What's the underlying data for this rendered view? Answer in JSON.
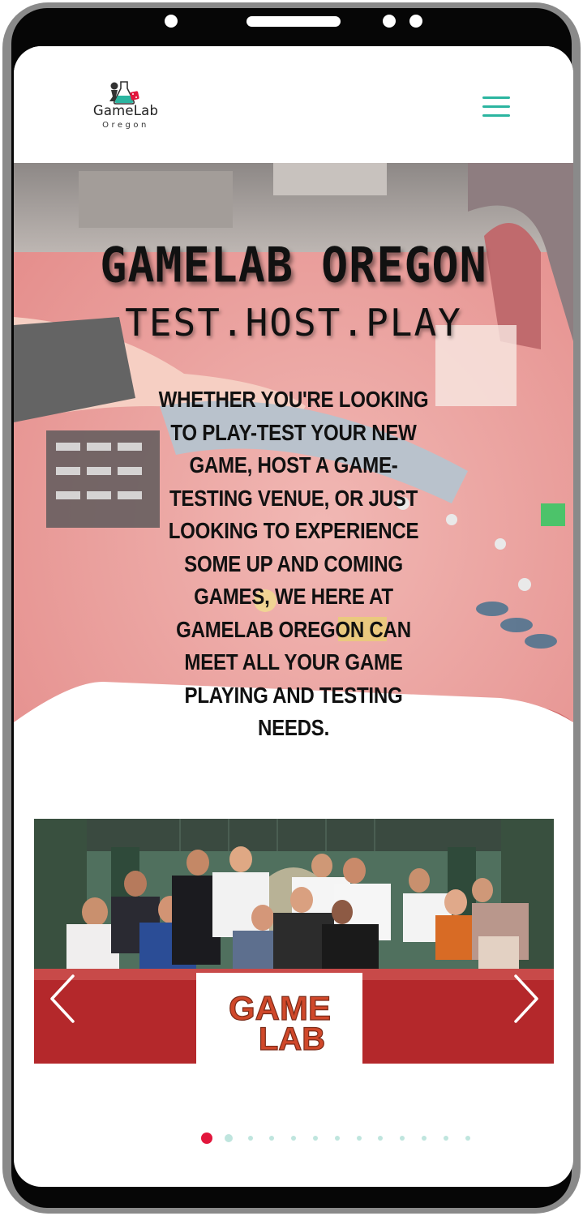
{
  "header": {
    "logo_text": "GameLab",
    "logo_subtext": "Oregon"
  },
  "hero": {
    "title": "GAMELAB OREGON",
    "tagline": "TEST.HOST.PLAY",
    "description": "Whether you're looking to play-test your new game, host a game-testing venue, or just looking to experience some up and coming games, we here at GameLab Oregon can meet all your game playing and testing needs."
  },
  "slider": {
    "banner_text_line1": "GAME",
    "banner_text_line2": "LAB",
    "slide_count": 13,
    "active_slide": 1
  },
  "colors": {
    "accent": "#2bb5a0",
    "active_dot": "#e2163c",
    "inactive_dot": "#bfe5de",
    "hero_overlay": "#e9a7a4"
  }
}
